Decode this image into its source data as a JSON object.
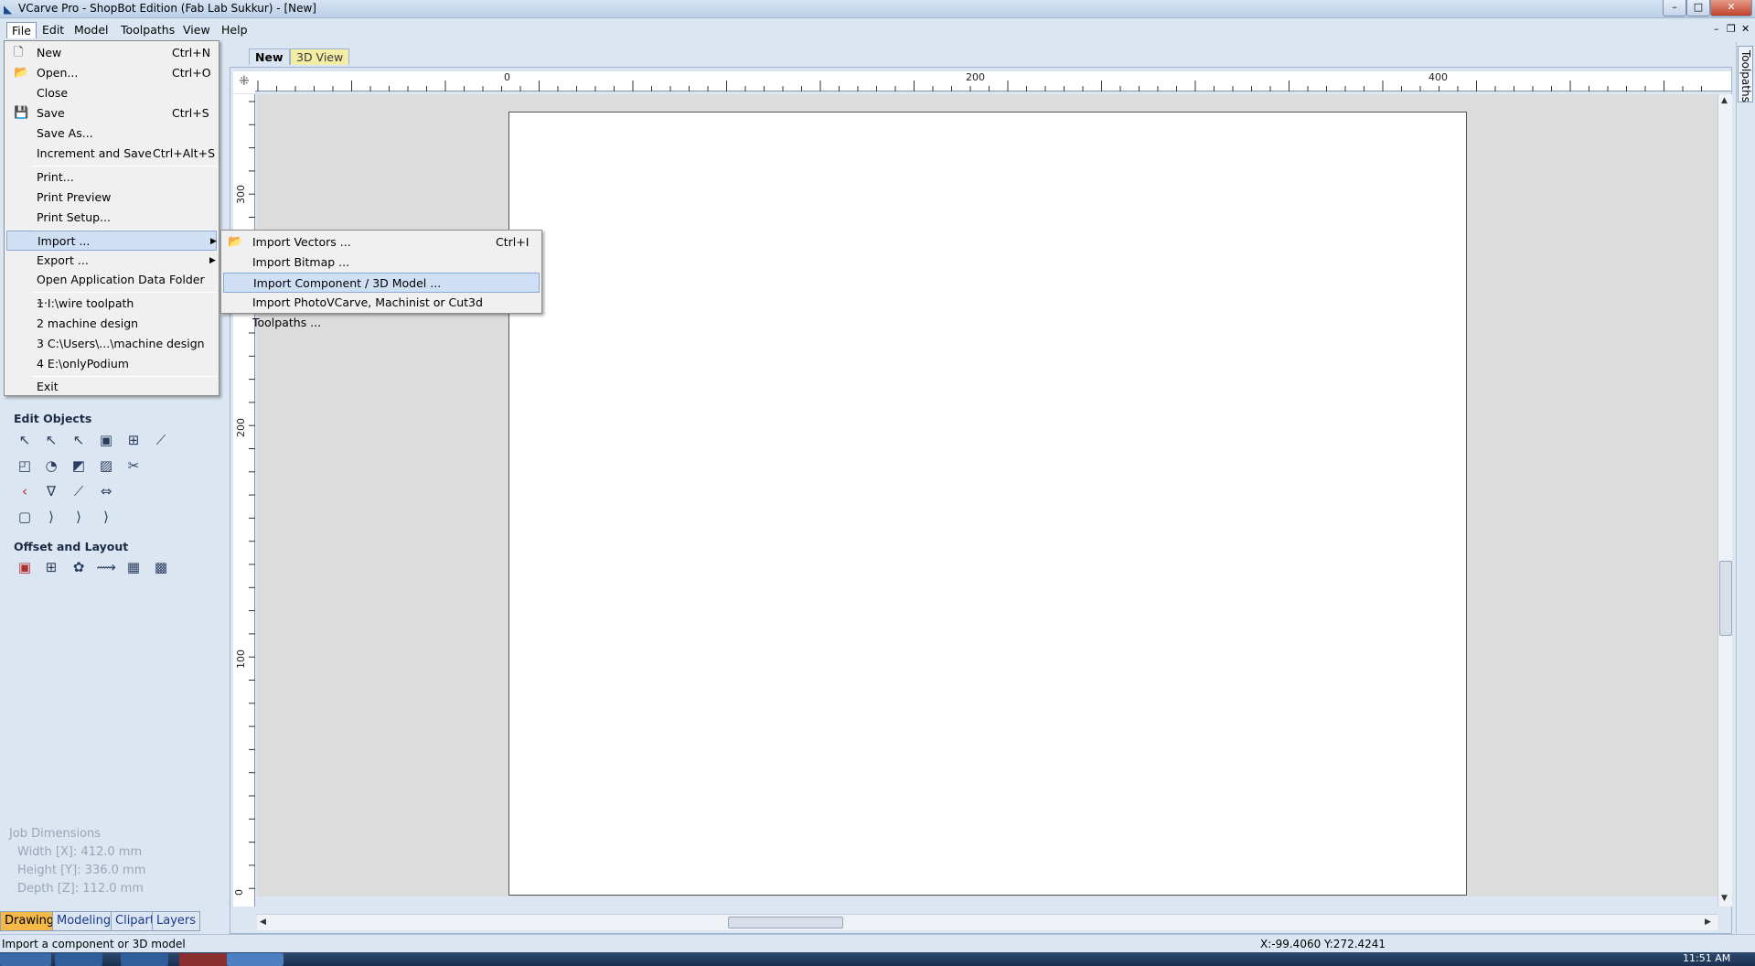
{
  "window": {
    "title": "VCarve Pro - ShopBot Edition (Fab Lab Sukkur) - [New]",
    "controls": {
      "minimize": "–",
      "maximize": "□",
      "close": "✕"
    }
  },
  "menubar": {
    "items": [
      {
        "label": "File"
      },
      {
        "label": "Edit"
      },
      {
        "label": "Model"
      },
      {
        "label": "Toolpaths"
      },
      {
        "label": "View"
      },
      {
        "label": "Help"
      }
    ],
    "mdi_controls": {
      "minimize": "–",
      "restore": "❐",
      "close": "✕"
    }
  },
  "file_menu": {
    "items": [
      {
        "label": "New",
        "shortcut": "Ctrl+N",
        "icon": "new-document-icon"
      },
      {
        "label": "Open...",
        "shortcut": "Ctrl+O",
        "icon": "open-folder-icon"
      },
      {
        "label": "Close",
        "shortcut": ""
      },
      {
        "label": "Save",
        "shortcut": "Ctrl+S",
        "icon": "save-disk-icon"
      },
      {
        "label": "Save As...",
        "shortcut": ""
      },
      {
        "label": "Increment and Save",
        "shortcut": "Ctrl+Alt+S"
      },
      {
        "label": "Print...",
        "shortcut": ""
      },
      {
        "label": "Print Preview",
        "shortcut": ""
      },
      {
        "label": "Print Setup...",
        "shortcut": ""
      },
      {
        "label": "Import ...",
        "submenu": true,
        "highlighted": true
      },
      {
        "label": "Export ...",
        "submenu": true
      },
      {
        "label": "Open Application Data Folder ...",
        "shortcut": ""
      },
      {
        "label": "1 I:\\wire toolpath"
      },
      {
        "label": "2 machine design"
      },
      {
        "label": "3 C:\\Users\\...\\machine design"
      },
      {
        "label": "4 E:\\onlyPodium"
      },
      {
        "label": "Exit"
      }
    ]
  },
  "import_submenu": {
    "items": [
      {
        "label": "Import Vectors ...",
        "shortcut": "Ctrl+I",
        "icon": "import-vectors-icon"
      },
      {
        "label": "Import Bitmap ...",
        "shortcut": ""
      },
      {
        "label": "Import Component / 3D Model ...",
        "shortcut": "",
        "highlighted": true
      },
      {
        "label": "Import PhotoVCarve, Machinist or Cut3d Toolpaths ...",
        "shortcut": ""
      }
    ]
  },
  "left_panel": {
    "edit_objects_title": "Edit Objects",
    "offset_layout_title": "Offset and Layout",
    "job_dimensions": {
      "title": "Job Dimensions",
      "width": "Width  [X]: 412.0 mm",
      "height": "Height [Y]: 336.0 mm",
      "depth": "Depth  [Z]: 112.0 mm"
    },
    "tabs": [
      {
        "label": "Drawing",
        "active": true
      },
      {
        "label": "Modeling"
      },
      {
        "label": "Clipart"
      },
      {
        "label": "Layers"
      }
    ]
  },
  "document_tabs": [
    {
      "label": "New",
      "active": true
    },
    {
      "label": "3D View"
    }
  ],
  "rulers": {
    "horizontal": [
      "0",
      "200",
      "400"
    ],
    "vertical": [
      "300",
      "200",
      "100",
      "0"
    ]
  },
  "right_tab": {
    "label": "Toolpaths"
  },
  "status_bar": {
    "message": "Import a component or 3D model",
    "coords": "X:-99.4060 Y:272.4241"
  },
  "taskbar": {
    "time": "11:51 AM"
  }
}
